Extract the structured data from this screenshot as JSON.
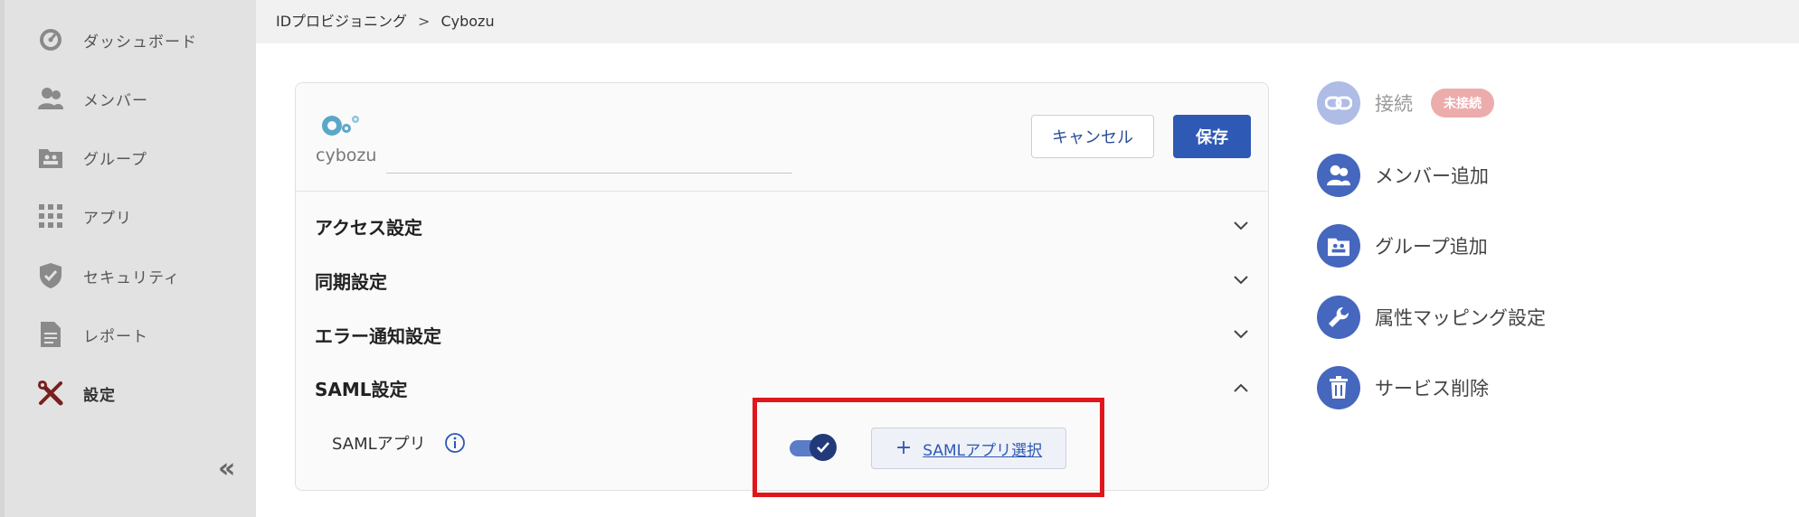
{
  "breadcrumb": {
    "parent": "IDプロビジョニング",
    "separator": ">",
    "current": "Cybozu"
  },
  "sidebar": {
    "items": [
      {
        "label": "ダッシュボード",
        "icon": "dashboard-icon"
      },
      {
        "label": "メンバー",
        "icon": "members-icon"
      },
      {
        "label": "グループ",
        "icon": "group-icon"
      },
      {
        "label": "アプリ",
        "icon": "apps-grid-icon"
      },
      {
        "label": "セキュリティ",
        "icon": "shield-icon"
      },
      {
        "label": "レポート",
        "icon": "report-icon"
      },
      {
        "label": "設定",
        "icon": "tools-icon"
      }
    ],
    "active": "設定",
    "collapse_label": "«"
  },
  "card": {
    "logo_text": "cybozu",
    "cancel_label": "キャンセル",
    "save_label": "保存",
    "sections": [
      {
        "title": "アクセス設定",
        "expanded": false
      },
      {
        "title": "同期設定",
        "expanded": false
      },
      {
        "title": "エラー通知設定",
        "expanded": false
      },
      {
        "title": "SAML設定",
        "expanded": true
      }
    ],
    "saml": {
      "app_label": "SAMLアプリ",
      "toggle_on": true,
      "select_plus": "+",
      "select_label": "SAMLアプリ選択"
    }
  },
  "actions": {
    "connect": {
      "label": "接続",
      "badge": "未接続"
    },
    "add_member": "メンバー追加",
    "add_group": "グループ追加",
    "attr_mapping": "属性マッピング設定",
    "delete_service": "サービス削除"
  },
  "colors": {
    "accent": "#2e59b5",
    "highlight": "#e0161d",
    "badge": "#ecacac",
    "sidebar": "#e2e2e2"
  }
}
